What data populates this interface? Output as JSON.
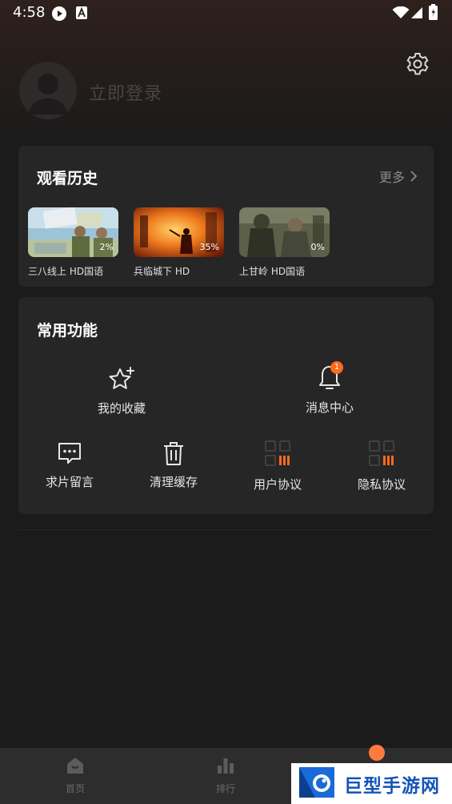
{
  "status_bar": {
    "time": "4:58"
  },
  "header": {
    "login_text": "立即登录"
  },
  "history": {
    "title": "观看历史",
    "more_label": "更多",
    "items": [
      {
        "title": "三八线上 HD国语",
        "progress": "2%"
      },
      {
        "title": "兵临城下 HD",
        "progress": "35%"
      },
      {
        "title": "上甘岭 HD国语",
        "progress": "0%"
      }
    ]
  },
  "tools": {
    "title": "常用功能",
    "favorites": "我的收藏",
    "messages": "消息中心",
    "message_badge": "1",
    "request": "求片留言",
    "clear_cache": "清理缓存",
    "user_agreement": "用户协议",
    "privacy": "隐私协议"
  },
  "nav": {
    "home": "首页",
    "rank": "排行"
  },
  "watermark": {
    "text": "巨型手游网"
  },
  "colors": {
    "accent": "#ff6a1f",
    "card": "#262626",
    "background": "#1b1b1b"
  }
}
